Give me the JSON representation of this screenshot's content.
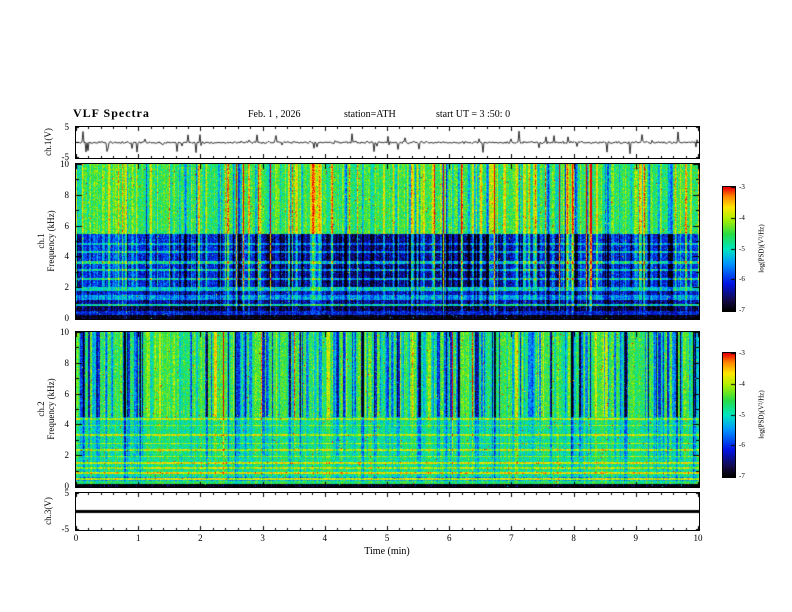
{
  "header": {
    "title": "VLF Spectra",
    "date_label": "Feb. 1 , 2026",
    "station_label": "station=ATH",
    "start_label": "start UT =  3 :50: 0"
  },
  "xaxis": {
    "label": "Time (min)",
    "lim": [
      0,
      10
    ],
    "ticks": [
      0,
      1,
      2,
      3,
      4,
      5,
      6,
      7,
      8,
      9,
      10
    ]
  },
  "colorbar": {
    "label": "log(PSD)(V²/Hz)",
    "lim": [
      -7,
      -3
    ],
    "ticks": [
      -3,
      -4,
      -5,
      -6,
      -7
    ]
  },
  "style": {
    "axis_color": "#000000",
    "background": "#ffffff",
    "trace_color": "#000000",
    "colormap": [
      {
        "t": 0.0,
        "c": [
          0,
          0,
          0
        ]
      },
      {
        "t": 0.08,
        "c": [
          20,
          10,
          70
        ]
      },
      {
        "t": 0.22,
        "c": [
          0,
          20,
          230
        ]
      },
      {
        "t": 0.38,
        "c": [
          0,
          150,
          255
        ]
      },
      {
        "t": 0.5,
        "c": [
          0,
          230,
          190
        ]
      },
      {
        "t": 0.62,
        "c": [
          40,
          220,
          70
        ]
      },
      {
        "t": 0.74,
        "c": [
          170,
          240,
          0
        ]
      },
      {
        "t": 0.84,
        "c": [
          255,
          230,
          0
        ]
      },
      {
        "t": 0.93,
        "c": [
          255,
          130,
          0
        ]
      },
      {
        "t": 1.0,
        "c": [
          235,
          0,
          0
        ]
      }
    ]
  },
  "chart_data": [
    {
      "id": "ch1_waveform",
      "type": "line",
      "ylabel": "ch.1(V)",
      "ylim": [
        -5,
        5
      ],
      "yticks": [
        {
          "v": 5,
          "label": "5"
        },
        {
          "v": -5,
          "label": "-5"
        }
      ],
      "xlim": [
        0,
        10
      ],
      "description": "Broadband noisy voltage trace centred near 0 V with frequent impulsive sferic spikes reaching toward ±5 V across the full 10 minutes",
      "render": {
        "seed": 11,
        "noise_amp": 0.45,
        "spike_prob": 0.08,
        "spike_min": 0.8,
        "spike_max": 4.6
      }
    },
    {
      "id": "ch1_spectrogram",
      "type": "heatmap",
      "ylabel": "ch.1 Frequency (kHz)",
      "ylabel_line1": "ch.1",
      "ylabel_line2": "Frequency (kHz)",
      "ylim": [
        0,
        10
      ],
      "yticks": [
        {
          "v": 0,
          "label": "0"
        },
        {
          "v": 2,
          "label": "2"
        },
        {
          "v": 4,
          "label": "4"
        },
        {
          "v": 6,
          "label": "6"
        },
        {
          "v": 8,
          "label": "8"
        },
        {
          "v": 10,
          "label": "10"
        }
      ],
      "xlim": [
        0,
        10
      ],
      "zlim": [
        -7,
        -3
      ],
      "description": "Green background (~-4.5) above 5.5 kHz with dense vertical transient stripes; deep blue attenuated band (~-6 to -6.5) between 2 and 5.5 kHz strongest from ~2.5 to 7.5 min with narrow green horizontal lines; dark/black band below 1 kHz with a green line near 0.85 kHz",
      "render": {
        "seed": 21,
        "noise": 0.85,
        "speckle_prob": 0.004,
        "speckle_boost": 1.6,
        "bands": [
          [
            0,
            0.22,
            -7
          ],
          [
            0.22,
            0.5,
            -6.1
          ],
          [
            0.5,
            0.78,
            -6.7
          ],
          [
            0.78,
            0.95,
            -5.0
          ],
          [
            0.95,
            1.2,
            -6.4
          ],
          [
            1.2,
            1.5,
            -5.5
          ],
          [
            1.5,
            1.8,
            -6.2
          ],
          [
            1.8,
            2.05,
            -5.1
          ],
          [
            2.05,
            5.5,
            -6.0
          ],
          [
            5.5,
            10,
            -4.55
          ]
        ],
        "lines": [
          [
            2.55,
            0.08,
            -4.9
          ],
          [
            3.15,
            0.06,
            -5.0
          ],
          [
            3.65,
            0.08,
            -4.8
          ],
          [
            4.3,
            0.06,
            -5.05
          ],
          [
            4.85,
            0.05,
            -5.2
          ]
        ],
        "time_dips": [
          [
            0.27,
            0.73,
            2.05,
            5.5,
            -0.5
          ]
        ],
        "stripes": {
          "count": 270,
          "min": -1.35,
          "max": 1.6,
          "zones": [
            [
              5.5,
              10,
              1.0
            ],
            [
              2.05,
              5.5,
              1.25
            ],
            [
              0.5,
              2.05,
              0.6
            ],
            [
              0,
              0.5,
              0.15
            ]
          ]
        },
        "bright_stripes": {
          "count": 6,
          "amp": 2.1
        }
      }
    },
    {
      "id": "ch2_spectrogram",
      "type": "heatmap",
      "ylabel": "ch.2 Frequency (kHz)",
      "ylabel_line1": "ch.2",
      "ylabel_line2": "Frequency (kHz)",
      "ylim": [
        0,
        10
      ],
      "yticks": [
        {
          "v": 0,
          "label": "0"
        },
        {
          "v": 2,
          "label": "2"
        },
        {
          "v": 4,
          "label": "4"
        },
        {
          "v": 6,
          "label": "6"
        },
        {
          "v": 8,
          "label": "8"
        },
        {
          "v": 10,
          "label": "10"
        }
      ],
      "xlim": [
        0,
        10
      ],
      "zlim": [
        -7,
        -3
      ],
      "description": "Green background (~-4.5) above 4.5 kHz cut by many strong dark-blue vertical stripes; below 4.5 kHz brighter yellow-green field with numerous narrow yellow/orange horizontal power lines (~0.5 to 4.4 kHz); thin black band at the very bottom near 0 kHz",
      "render": {
        "seed": 37,
        "noise": 0.8,
        "speckle_prob": 0.006,
        "speckle_boost": 1.5,
        "bands": [
          [
            0,
            0.14,
            -7
          ],
          [
            0.14,
            0.38,
            -4.6
          ],
          [
            0.38,
            0.6,
            -5.3
          ],
          [
            0.6,
            4.5,
            -4.75
          ],
          [
            4.5,
            10,
            -4.5
          ]
        ],
        "lines": [
          [
            0.5,
            0.07,
            -3.8
          ],
          [
            0.85,
            0.06,
            -3.6
          ],
          [
            1.2,
            0.05,
            -3.95
          ],
          [
            1.55,
            0.06,
            -3.7
          ],
          [
            1.95,
            0.05,
            -4.05
          ],
          [
            2.35,
            0.06,
            -3.8
          ],
          [
            2.8,
            0.05,
            -4.0
          ],
          [
            3.35,
            0.06,
            -3.85
          ],
          [
            3.95,
            0.05,
            -4.1
          ],
          [
            4.4,
            0.05,
            -3.9
          ]
        ],
        "time_dips": [],
        "stripes": {
          "count": 300,
          "min": -2.1,
          "max": 0.8,
          "zones": [
            [
              4.5,
              10,
              1.0
            ],
            [
              2.0,
              4.5,
              0.4
            ],
            [
              0.5,
              2.0,
              0.25
            ],
            [
              0,
              0.5,
              0.1
            ]
          ]
        },
        "bright_stripes": {
          "count": 4,
          "amp": 1.6
        }
      }
    },
    {
      "id": "ch3_waveform",
      "type": "line",
      "ylabel": "ch.3(V)",
      "ylim": [
        -5,
        5
      ],
      "yticks": [
        {
          "v": 5,
          "label": "5"
        },
        {
          "v": -5,
          "label": "-5"
        }
      ],
      "xlim": [
        0,
        10
      ],
      "description": "Flat black trace pinned at 0 V for the whole record (no signal on channel 3)",
      "render": {
        "flat": true,
        "value": 0,
        "thickness": 3
      }
    }
  ]
}
